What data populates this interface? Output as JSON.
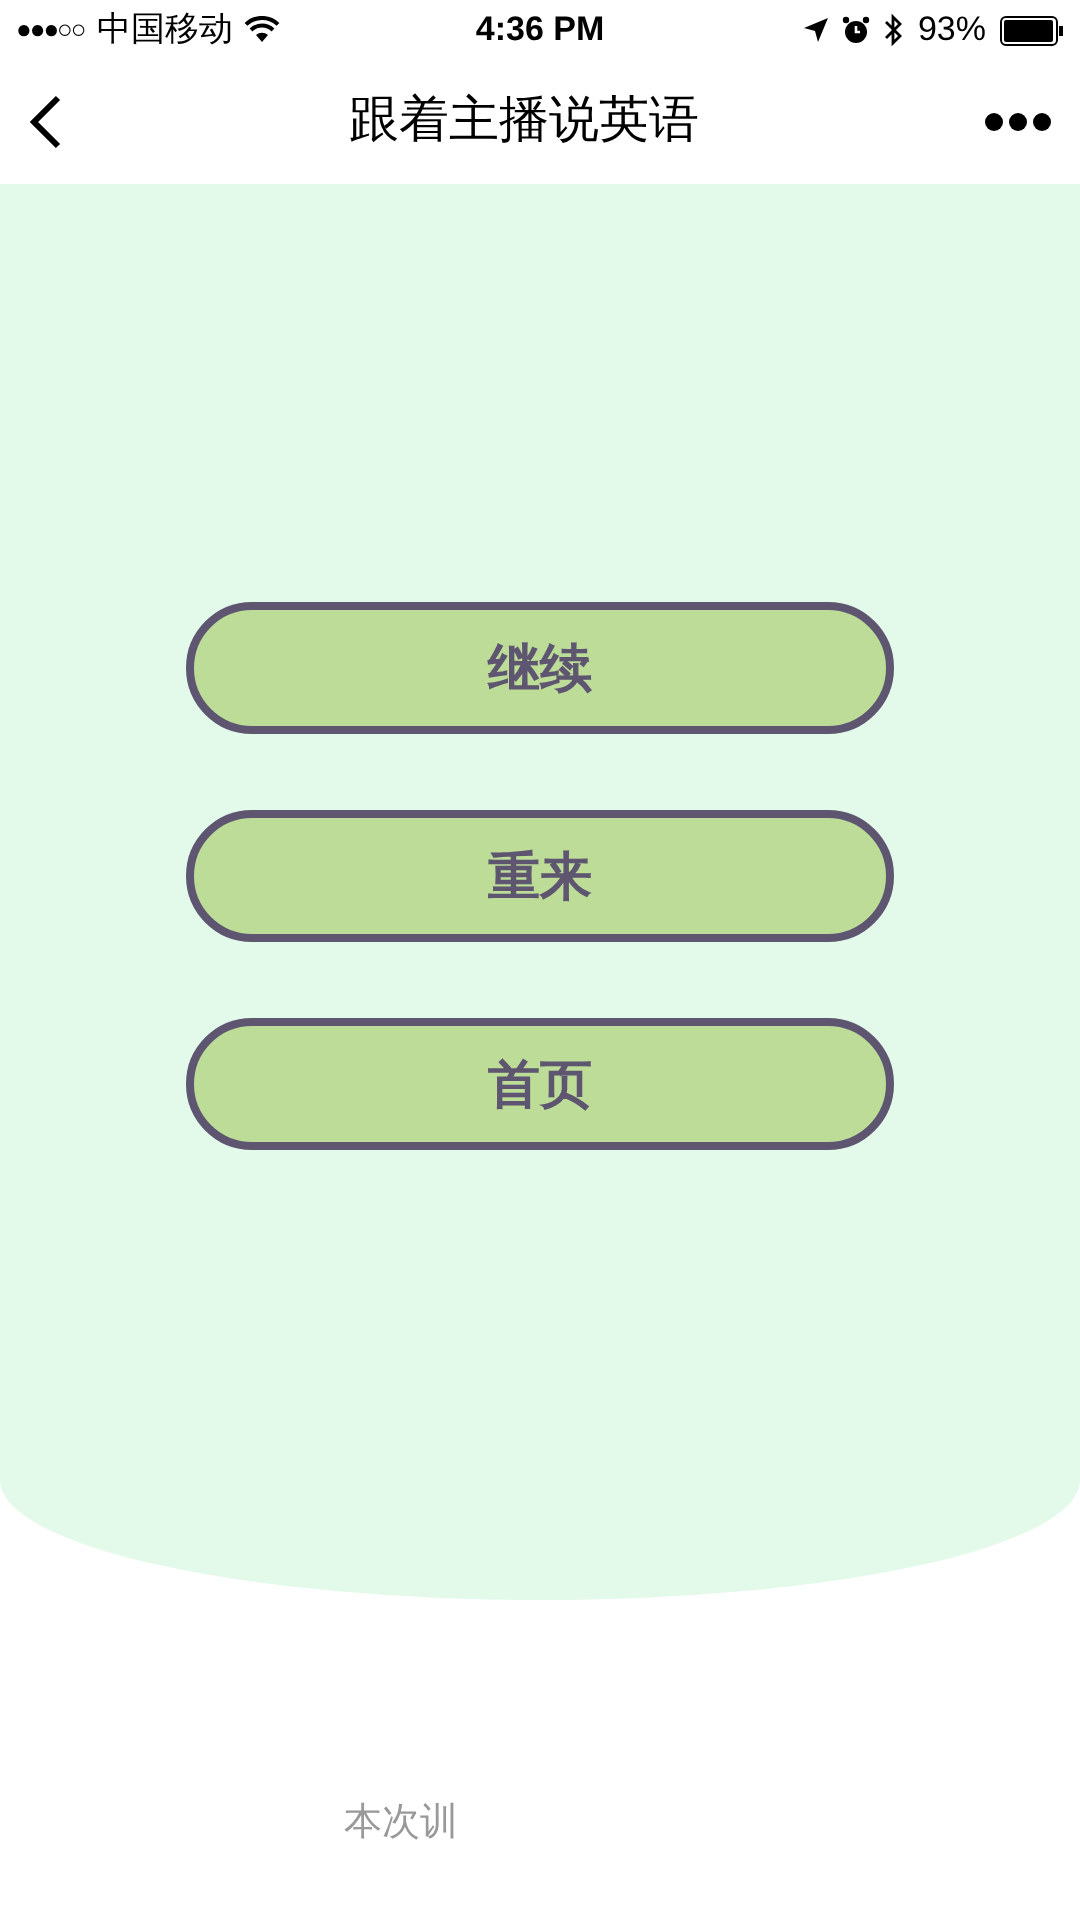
{
  "status_bar": {
    "signal_dots": "●●●○○",
    "carrier": "中国移动",
    "time": "4:36 PM",
    "battery": "93%"
  },
  "nav_bar": {
    "title": "跟着主播说英语"
  },
  "buttons": [
    {
      "label": "继续"
    },
    {
      "label": "重来"
    },
    {
      "label": "首页"
    }
  ],
  "footer_text": "本次训"
}
